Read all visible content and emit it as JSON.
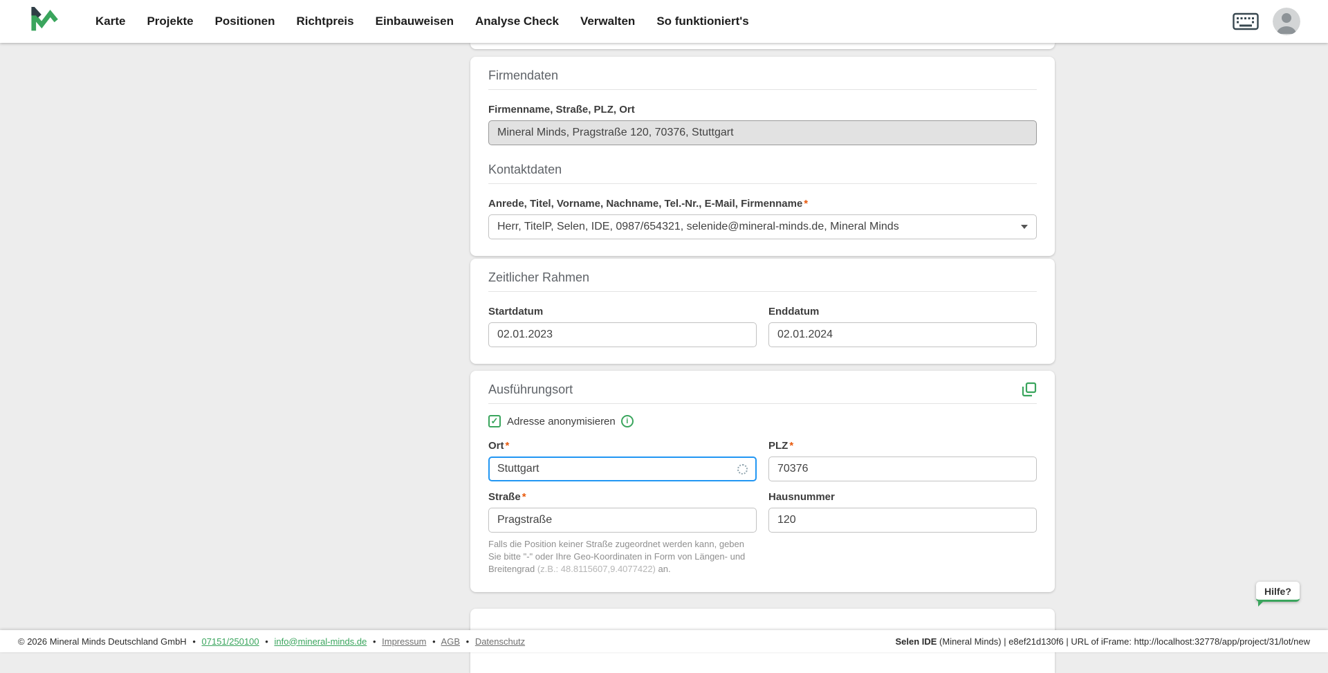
{
  "nav": {
    "items": [
      {
        "label": "Karte"
      },
      {
        "label": "Projekte"
      },
      {
        "label": "Positionen"
      },
      {
        "label": "Richtpreis"
      },
      {
        "label": "Einbauweisen"
      },
      {
        "label": "Analyse Check"
      },
      {
        "label": "Verwalten"
      },
      {
        "label": "So funktioniert's"
      }
    ]
  },
  "common": {
    "required_mark": "*",
    "separator": "•"
  },
  "firmendaten": {
    "title": "Firmendaten",
    "company_label": "Firmenname, Straße, PLZ, Ort",
    "company_value": "Mineral Minds, Pragstraße 120, 70376, Stuttgart",
    "kontakt_title": "Kontaktdaten",
    "kontakt_label": "Anrede, Titel, Vorname, Nachname, Tel.-Nr., E-Mail, Firmenname",
    "kontakt_value": "Herr, TitelP, Selen, IDE, 0987/654321, selenide@mineral-minds.de, Mineral Minds"
  },
  "zeitlicher_rahmen": {
    "title": "Zeitlicher Rahmen",
    "startdatum_label": "Startdatum",
    "startdatum_value": "02.01.2023",
    "enddatum_label": "Enddatum",
    "enddatum_value": "02.01.2024"
  },
  "ausfuehrungsort": {
    "title": "Ausführungsort",
    "anonymisieren_label": "Adresse anonymisieren",
    "checkbox_mark": "✓",
    "info_mark": "i",
    "ort_label": "Ort",
    "ort_value": "Stuttgart",
    "plz_label": "PLZ",
    "plz_value": "70376",
    "strasse_label": "Straße",
    "strasse_value": "Pragstraße",
    "hausnummer_label": "Hausnummer",
    "hausnummer_value": "120",
    "hint_main": "Falls die Position keiner Straße zugeordnet werden kann, geben Sie bitte \"-\" oder Ihre Geo-Koordinaten in Form von Längen- und Breitengrad ",
    "hint_example": "(z.B.: 48.8115607,9.4077422)",
    "hint_suffix": " an."
  },
  "help": {
    "label": "Hilfe?"
  },
  "footer": {
    "copyright": "© 2026 Mineral Minds Deutschland GmbH",
    "phone": "07151/250100",
    "email": "info@mineral-minds.de",
    "impressum": "Impressum",
    "agb": "AGB",
    "datenschutz": "Datenschutz",
    "right_bold": "Selen IDE",
    "right_rest": " (Mineral Minds) | e8ef21d130f6 | URL of iFrame: http://localhost:32778/app/project/31/lot/new"
  },
  "icons": {
    "logo": "mineral-minds-logo",
    "nav_right": [
      "keyboard-icon",
      "user-avatar-icon"
    ],
    "duplicate": "duplicate-icon",
    "info": "info-icon",
    "loading": "spinner-icon",
    "caret": "caret-down-icon"
  },
  "colors": {
    "accent_green": "#3aa55d",
    "focus_blue": "#2196f3",
    "required_orange": "#e8590c",
    "page_background": "#ededed"
  }
}
